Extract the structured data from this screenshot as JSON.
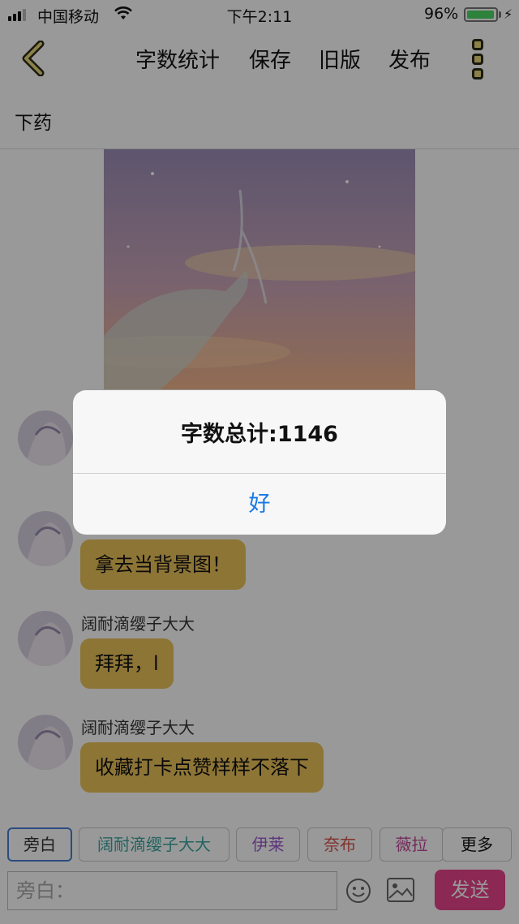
{
  "status": {
    "carrier": "中国移动",
    "time": "下午2:11",
    "battery": "96%",
    "battery_level": 0.96
  },
  "toolbar": {
    "word_count": "字数统计",
    "save": "保存",
    "old_version": "旧版",
    "publish": "发布"
  },
  "chapter": {
    "title": "下药"
  },
  "messages": [
    {
      "sender": "",
      "text": ""
    },
    {
      "sender": "",
      "text": "拿去当背景图！"
    },
    {
      "sender": "阔耐滴缨子大大",
      "text": "拜拜，l"
    },
    {
      "sender": "阔耐滴缨子大大",
      "text": "收藏打卡点赞样样不落下"
    }
  ],
  "roles": [
    {
      "label": "旁白",
      "color": "#333333"
    },
    {
      "label": "阔耐滴缨子大大",
      "color": "#3aa6a0"
    },
    {
      "label": "伊莱",
      "color": "#9b5bd0"
    },
    {
      "label": "奈布",
      "color": "#d9534f"
    },
    {
      "label": "薇拉",
      "color": "#c2489a"
    },
    {
      "label": "更多",
      "color": "#111111"
    }
  ],
  "input": {
    "placeholder": "旁白："
  },
  "send_label": "发送",
  "alert": {
    "message": "字数总计:1146",
    "ok": "好"
  },
  "colors": {
    "bubble": "#ecc35a",
    "send": "#e8438a",
    "alert_button": "#1678e6"
  }
}
